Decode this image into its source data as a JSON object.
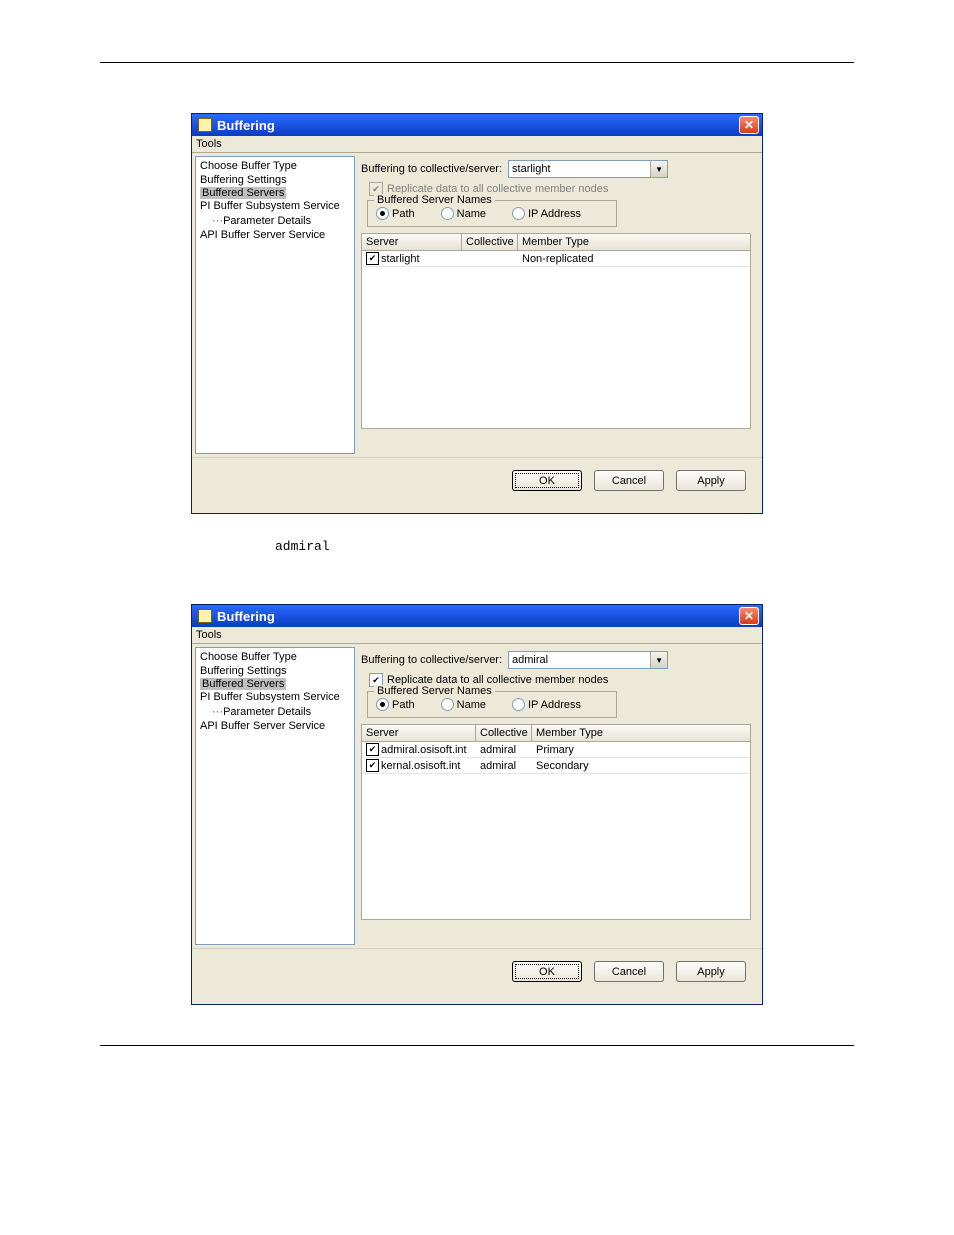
{
  "caption_between": "admiral",
  "dialog1": {
    "title": "Buffering",
    "menu": {
      "tools": "Tools"
    },
    "tree": {
      "items": [
        "Choose Buffer Type",
        "Buffering Settings",
        "Buffered Servers",
        "PI Buffer Subsystem Service",
        "Parameter Details",
        "API Buffer Server Service"
      ],
      "selected_index": 2
    },
    "buffering_label": "Buffering to collective/server:",
    "selected_server": "starlight",
    "replicate_label": "Replicate data to all collective member nodes",
    "replicate_checked": true,
    "replicate_disabled": true,
    "fieldset_legend": "Buffered Server Names",
    "radios": {
      "path": "Path",
      "name": "Name",
      "ip": "IP Address",
      "selected": "path"
    },
    "grid": {
      "headers": {
        "server": "Server",
        "collective": "Collective",
        "member": "Member Type"
      },
      "rows": [
        {
          "checked": true,
          "server": "starlight",
          "collective": "",
          "member": "Non-replicated"
        }
      ]
    },
    "buttons": {
      "ok": "OK",
      "cancel": "Cancel",
      "apply": "Apply"
    }
  },
  "dialog2": {
    "title": "Buffering",
    "menu": {
      "tools": "Tools"
    },
    "tree": {
      "items": [
        "Choose Buffer Type",
        "Buffering Settings",
        "Buffered Servers",
        "PI Buffer Subsystem Service",
        "Parameter Details",
        "API Buffer Server Service"
      ],
      "selected_index": 2
    },
    "buffering_label": "Buffering to collective/server:",
    "selected_server": "admiral",
    "replicate_label": "Replicate data to all collective member nodes",
    "replicate_checked": true,
    "replicate_disabled": false,
    "fieldset_legend": "Buffered Server Names",
    "radios": {
      "path": "Path",
      "name": "Name",
      "ip": "IP Address",
      "selected": "path"
    },
    "grid": {
      "headers": {
        "server": "Server",
        "collective": "Collective",
        "member": "Member Type"
      },
      "rows": [
        {
          "checked": true,
          "server": "admiral.osisoft.int",
          "collective": "admiral",
          "member": "Primary"
        },
        {
          "checked": true,
          "server": "kernal.osisoft.int",
          "collective": "admiral",
          "member": "Secondary"
        }
      ]
    },
    "buttons": {
      "ok": "OK",
      "cancel": "Cancel",
      "apply": "Apply"
    }
  }
}
